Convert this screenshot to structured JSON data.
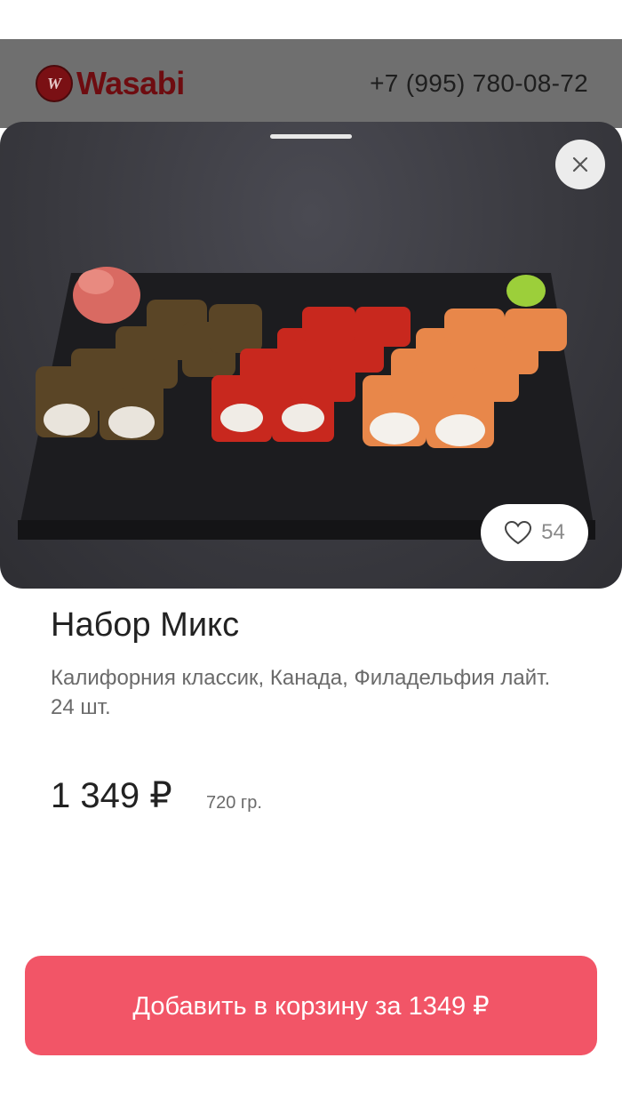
{
  "header": {
    "logo_text": "Wasabi",
    "logo_badge": "W",
    "phone": "+7 (995) 780-08-72"
  },
  "product": {
    "title": "Набор Микс",
    "description": "Калифорния классик, Канада, Филадельфия лайт. 24 шт.",
    "price": "1 349 ₽",
    "weight": "720 гр.",
    "likes": "54"
  },
  "actions": {
    "add_to_cart": "Добавить в корзину за 1349 ₽"
  },
  "icons": {
    "close": "close-icon",
    "like": "heart-icon"
  },
  "colors": {
    "accent": "#f25567",
    "brand": "#6e0c10",
    "header_dim": "#6f6f6f"
  }
}
